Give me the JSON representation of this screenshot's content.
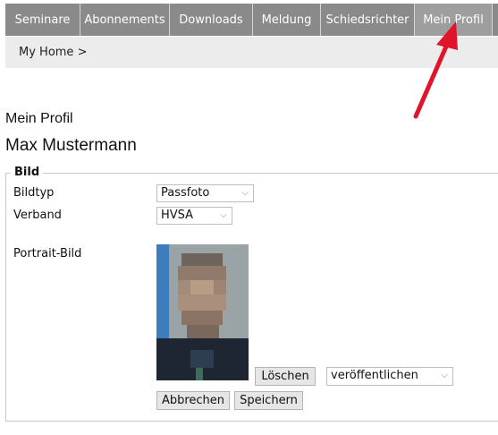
{
  "nav": {
    "tabs": [
      {
        "label": "Seminare"
      },
      {
        "label": "Abonnements"
      },
      {
        "label": "Downloads"
      },
      {
        "label": "Meldung"
      },
      {
        "label": "Schiedsrichter"
      },
      {
        "label": "Mein Profil"
      }
    ],
    "active_tab": "Mein Profil"
  },
  "breadcrumb": {
    "label": "My Home >"
  },
  "page": {
    "title": "Mein Profil",
    "person_name": "Max Mustermann"
  },
  "section": {
    "legend": "Bild",
    "fields": {
      "bildtyp": {
        "label": "Bildtyp",
        "value": "Passfoto"
      },
      "verband": {
        "label": "Verband",
        "value": "HVSA"
      },
      "portrait": {
        "label": "Portrait-Bild"
      }
    },
    "buttons": {
      "delete": "Löschen",
      "cancel": "Abbrechen",
      "save": "Speichern"
    },
    "visibility_select": {
      "value": "veröffentlichen"
    }
  },
  "colors": {
    "nav_bg": "#8a8a8a",
    "annotation_arrow": "#e0142a"
  }
}
